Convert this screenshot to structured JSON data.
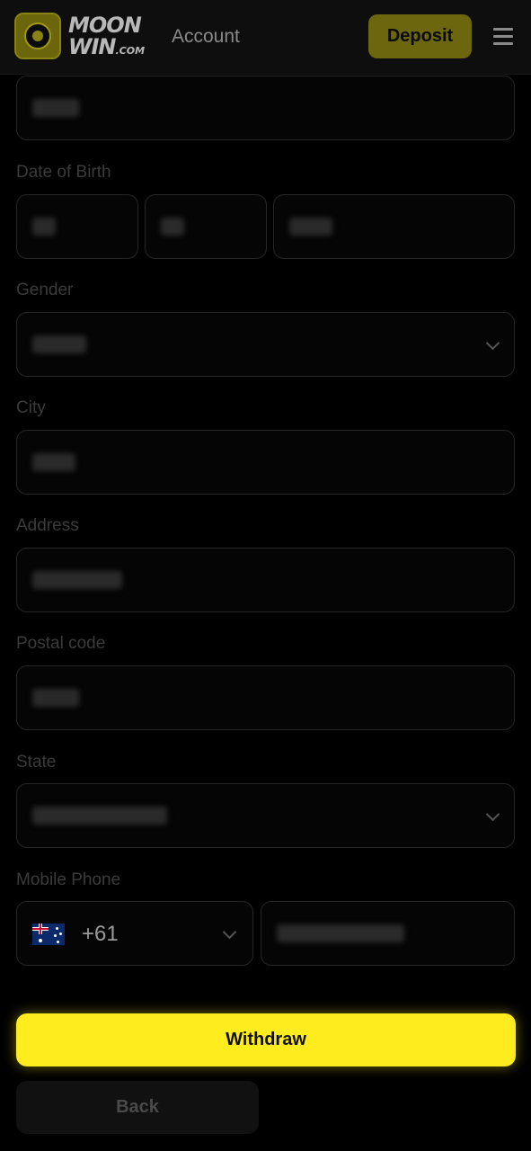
{
  "header": {
    "logo_line1": "MOON",
    "logo_line2": "WIN",
    "logo_suffix": ".COM",
    "title": "Account",
    "deposit_label": "Deposit",
    "menu_icon": "hamburger-menu-icon"
  },
  "form": {
    "dob_label": "Date of Birth",
    "gender_label": "Gender",
    "city_label": "City",
    "address_label": "Address",
    "postal_label": "Postal code",
    "state_label": "State",
    "phone_label": "Mobile Phone",
    "phone_country_code": "+61",
    "phone_country_flag": "australia-flag-icon"
  },
  "actions": {
    "withdraw_label": "Withdraw",
    "back_label": "Back"
  },
  "colors": {
    "accent": "#ffec1f",
    "deposit_bg": "#6c660f",
    "background": "#000000"
  }
}
